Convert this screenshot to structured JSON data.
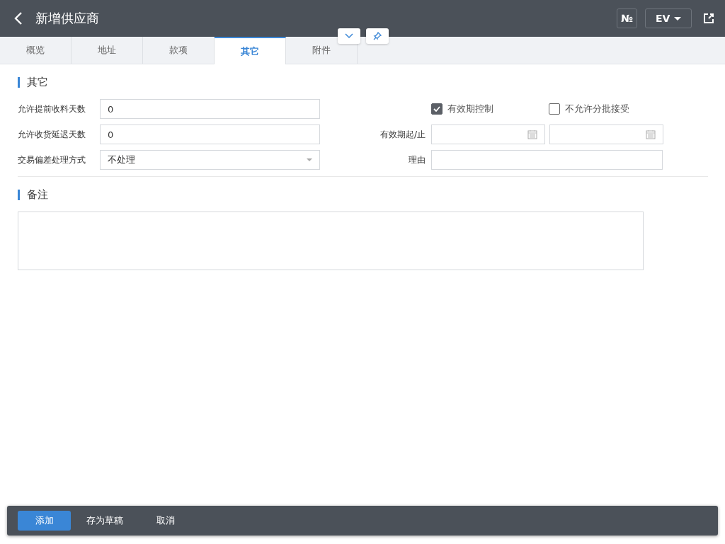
{
  "header": {
    "title": "新增供应商",
    "number_button": "№",
    "language": "EV"
  },
  "tabs": [
    {
      "label": "概览",
      "selected": false
    },
    {
      "label": "地址",
      "selected": false
    },
    {
      "label": "款项",
      "selected": false
    },
    {
      "label": "其它",
      "selected": true
    },
    {
      "label": "附件",
      "selected": false
    }
  ],
  "other": {
    "title": "其它",
    "left_fields": [
      {
        "label": "允许提前收料天数",
        "value": "0",
        "kind": "text"
      },
      {
        "label": "允许收货延迟天数",
        "value": "0",
        "kind": "text"
      },
      {
        "label": "交易偏差处理方式",
        "value": "不处理",
        "kind": "select"
      }
    ],
    "checkboxes": [
      {
        "label": "有效期控制",
        "checked": true
      },
      {
        "label": "不允许分批接受",
        "checked": false
      }
    ],
    "validity_label": "有效期起/止",
    "reason_label": "理由"
  },
  "notes": {
    "title": "备注"
  },
  "actions": [
    {
      "label": "添加",
      "kind": "primary"
    },
    {
      "label": "存为草稿",
      "kind": "plain"
    },
    {
      "label": "取消",
      "kind": "plain"
    }
  ]
}
